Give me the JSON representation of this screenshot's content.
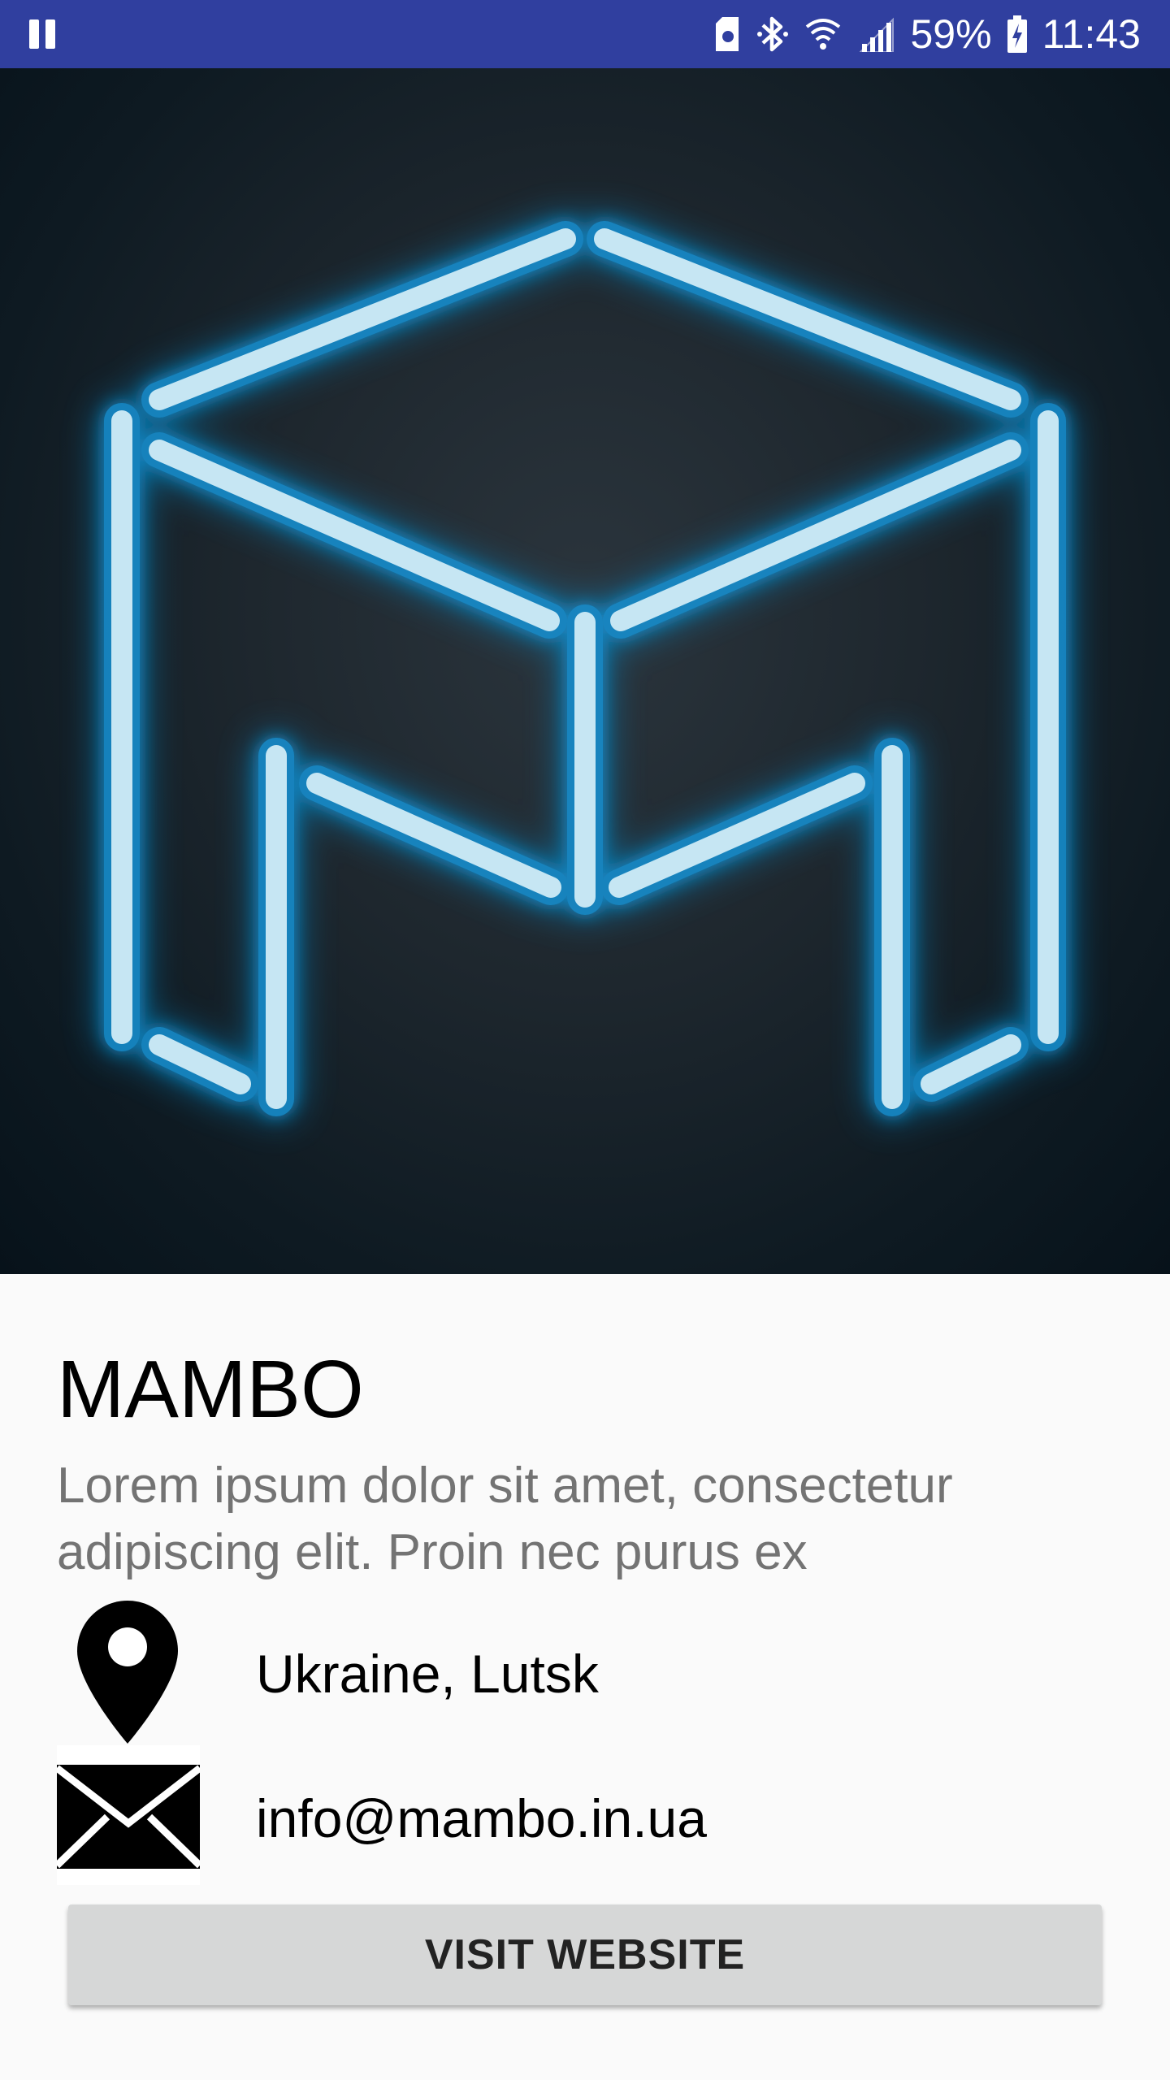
{
  "status_bar": {
    "battery_percent": "59%",
    "time": "11:43",
    "icons": [
      "pause-icon",
      "sim-card-icon",
      "bluetooth-icon",
      "wifi-icon",
      "cell-signal-icon",
      "battery-charging-icon"
    ]
  },
  "hero": {
    "image": "mambo-neon-cube-logo",
    "glow_color": "#1ea5e6",
    "tube_color": "#bfe3f2"
  },
  "company": {
    "name": "MAMBO",
    "description": "Lorem ipsum dolor sit amet, consectetur adipiscing elit. Proin nec purus ex"
  },
  "contact": {
    "location": "Ukraine, Lutsk",
    "email": "info@mambo.in.ua"
  },
  "actions": {
    "visit_label": "VISIT WEBSITE"
  },
  "colors": {
    "status_bar": "#303f9f",
    "button": "#d6d7d7"
  }
}
